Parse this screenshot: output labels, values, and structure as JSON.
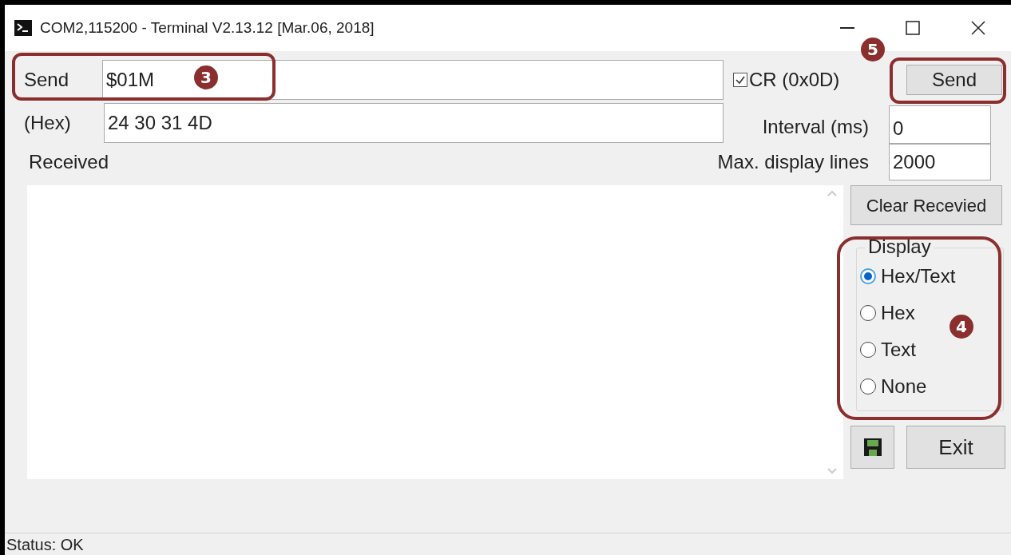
{
  "window": {
    "title": "COM2,115200 - Terminal V2.13.12 [Mar.06, 2018]"
  },
  "send": {
    "label": "Send",
    "value": "$01M",
    "hex_label": "(Hex)",
    "hex_value": "24 30 31 4D"
  },
  "cr_checkbox": {
    "label": "CR (0x0D)",
    "checked": true
  },
  "send_button": "Send",
  "interval": {
    "label": "Interval (ms)",
    "value": "0"
  },
  "max_lines": {
    "label": "Max. display lines",
    "value": "2000"
  },
  "received_label": "Received",
  "clear_button": "Clear Recevied",
  "display": {
    "title": "Display",
    "options": [
      {
        "label": "Hex/Text",
        "selected": true
      },
      {
        "label": "Hex",
        "selected": false
      },
      {
        "label": "Text",
        "selected": false
      },
      {
        "label": "None",
        "selected": false
      }
    ]
  },
  "exit_button": "Exit",
  "status": "Status: OK",
  "callouts": [
    "3",
    "4",
    "5"
  ]
}
